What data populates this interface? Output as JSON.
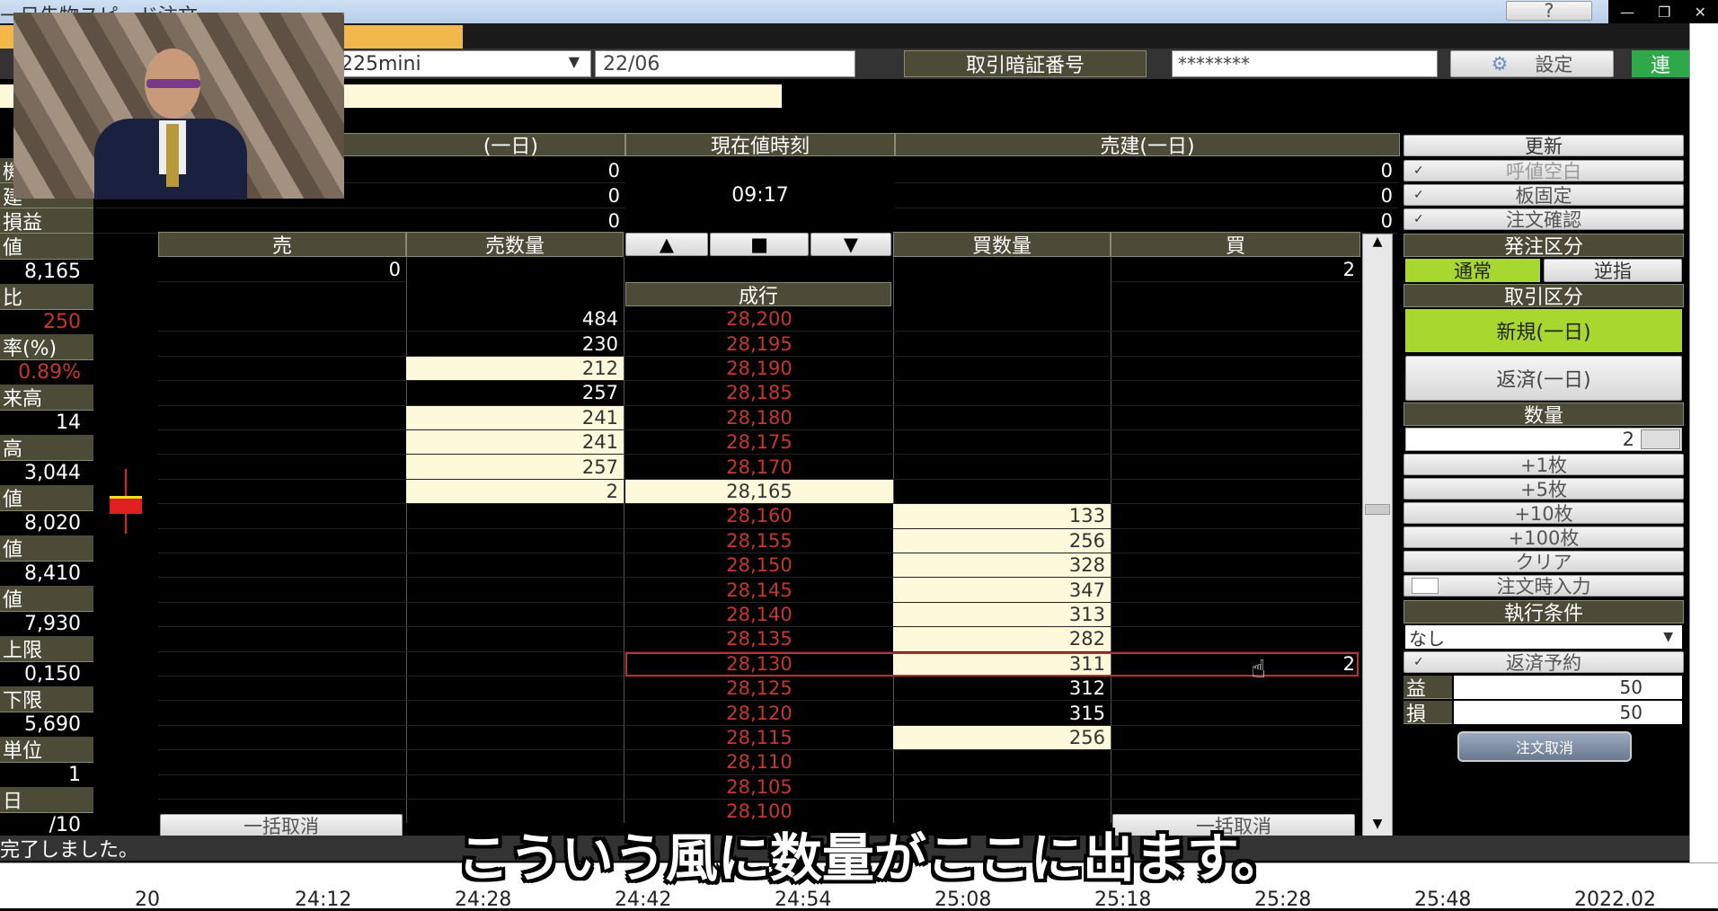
{
  "window": {
    "title": "一日先物スピード注文",
    "help_label": "?"
  },
  "top_bar": {
    "symbol": "225mini",
    "contract_month": "22/06",
    "pin_label": "取引暗証番号",
    "pin_value": "********",
    "settings_label": "設定",
    "connect_label": "連"
  },
  "summary": {
    "left_header": "(一日)",
    "time_header": "現在値時刻",
    "right_header": "売建(一日)",
    "time_value": "09:17",
    "left_values": [
      "0",
      "0",
      "0"
    ],
    "right_values": [
      "0",
      "0",
      "0"
    ]
  },
  "board": {
    "headers": {
      "sell": "売",
      "sell_qty": "売数量",
      "buy_qty": "買数量",
      "buy": "買"
    },
    "controls": {
      "up": "▲",
      "stop": "■",
      "down": "▼"
    },
    "top_row": {
      "sell": "0",
      "buy": "2"
    },
    "market_label": "成行",
    "rows": [
      {
        "price": "28,200",
        "sell_qty": "484",
        "buy_qty": "",
        "buy": ""
      },
      {
        "price": "28,195",
        "sell_qty": "230",
        "buy_qty": "",
        "buy": ""
      },
      {
        "price": "28,190",
        "sell_qty": "212",
        "buy_qty": "",
        "buy": ""
      },
      {
        "price": "28,185",
        "sell_qty": "257",
        "buy_qty": "",
        "buy": ""
      },
      {
        "price": "28,180",
        "sell_qty": "241",
        "buy_qty": "",
        "buy": ""
      },
      {
        "price": "28,175",
        "sell_qty": "241",
        "buy_qty": "",
        "buy": ""
      },
      {
        "price": "28,170",
        "sell_qty": "257",
        "buy_qty": "",
        "buy": ""
      },
      {
        "price": "28,165",
        "sell_qty": "2",
        "buy_qty": "",
        "buy": ""
      },
      {
        "price": "28,160",
        "sell_qty": "",
        "buy_qty": "133",
        "buy": ""
      },
      {
        "price": "28,155",
        "sell_qty": "",
        "buy_qty": "256",
        "buy": ""
      },
      {
        "price": "28,150",
        "sell_qty": "",
        "buy_qty": "328",
        "buy": ""
      },
      {
        "price": "28,145",
        "sell_qty": "",
        "buy_qty": "347",
        "buy": ""
      },
      {
        "price": "28,140",
        "sell_qty": "",
        "buy_qty": "313",
        "buy": ""
      },
      {
        "price": "28,135",
        "sell_qty": "",
        "buy_qty": "282",
        "buy": ""
      },
      {
        "price": "28,130",
        "sell_qty": "",
        "buy_qty": "311",
        "buy": "2"
      },
      {
        "price": "28,125",
        "sell_qty": "",
        "buy_qty": "312",
        "buy": ""
      },
      {
        "price": "28,120",
        "sell_qty": "",
        "buy_qty": "315",
        "buy": ""
      },
      {
        "price": "28,115",
        "sell_qty": "",
        "buy_qty": "256",
        "buy": ""
      },
      {
        "price": "28,110",
        "sell_qty": "",
        "buy_qty": "",
        "buy": ""
      },
      {
        "price": "28,105",
        "sell_qty": "",
        "buy_qty": "",
        "buy": ""
      },
      {
        "price": "28,100",
        "sell_qty": "",
        "buy_qty": "",
        "buy": ""
      }
    ],
    "bulk_cancel_sell": "一括取消",
    "bulk_cancel_buy": "一括取消"
  },
  "left_panel": {
    "rows": [
      {
        "label": "値",
        "value": ""
      },
      {
        "label": "",
        "value": "8,165"
      },
      {
        "label": "比",
        "value": ""
      },
      {
        "label": "",
        "value": "250"
      },
      {
        "label": "率(%)",
        "value": ""
      },
      {
        "label": "",
        "value": "0.89%"
      },
      {
        "label": "来高",
        "value": ""
      },
      {
        "label": "",
        "value": "14"
      },
      {
        "label": "高",
        "value": ""
      },
      {
        "label": "",
        "value": "3,044"
      },
      {
        "label": "値",
        "value": ""
      },
      {
        "label": "",
        "value": "8,020"
      },
      {
        "label": "値",
        "value": ""
      },
      {
        "label": "",
        "value": "8,410"
      },
      {
        "label": "値",
        "value": ""
      },
      {
        "label": "",
        "value": "7,930"
      },
      {
        "label": "上限",
        "value": ""
      },
      {
        "label": "",
        "value": "0,150"
      },
      {
        "label": "下限",
        "value": ""
      },
      {
        "label": "",
        "value": "5,690"
      },
      {
        "label": "単位",
        "value": ""
      },
      {
        "label": "",
        "value": "1"
      },
      {
        "label": "日",
        "value": ""
      },
      {
        "label": "",
        "value": "/10"
      }
    ],
    "top_labels": [
      "機",
      "建",
      "損益"
    ]
  },
  "right_panel": {
    "refresh": "更新",
    "quote_blank": "呼値空白",
    "board_fixed": "板固定",
    "order_confirm": "注文確認",
    "order_type_header": "発注区分",
    "order_normal": "通常",
    "order_reverse": "逆指",
    "trade_type_header": "取引区分",
    "new_order": "新規(一日)",
    "close_order": "返済(一日)",
    "qty_header": "数量",
    "qty_value": "2",
    "plus1": "+1枚",
    "plus5": "+5枚",
    "plus10": "+10枚",
    "plus100": "+100枚",
    "clear": "クリア",
    "order_input": "注文時入力",
    "exec_header": "執行条件",
    "exec_value": "なし",
    "close_reserve": "返済予約",
    "profit_label": "益",
    "profit_value": "50",
    "loss_label": "損",
    "loss_value": "50",
    "cancel_order": "注文取消"
  },
  "status": {
    "message": "完了しました。"
  },
  "subtitle": "こういう風に数量がここに出ます。",
  "time_axis": [
    "20",
    "24:12",
    "24:28",
    "24:42",
    "24:54",
    "25:08",
    "25:18",
    "25:28",
    "25:48",
    "2022.02"
  ],
  "colors": {
    "header_bg": "#4b4b38",
    "cream": "#fff9dc",
    "price_red": "#c8362c",
    "green": "#a8d830"
  }
}
